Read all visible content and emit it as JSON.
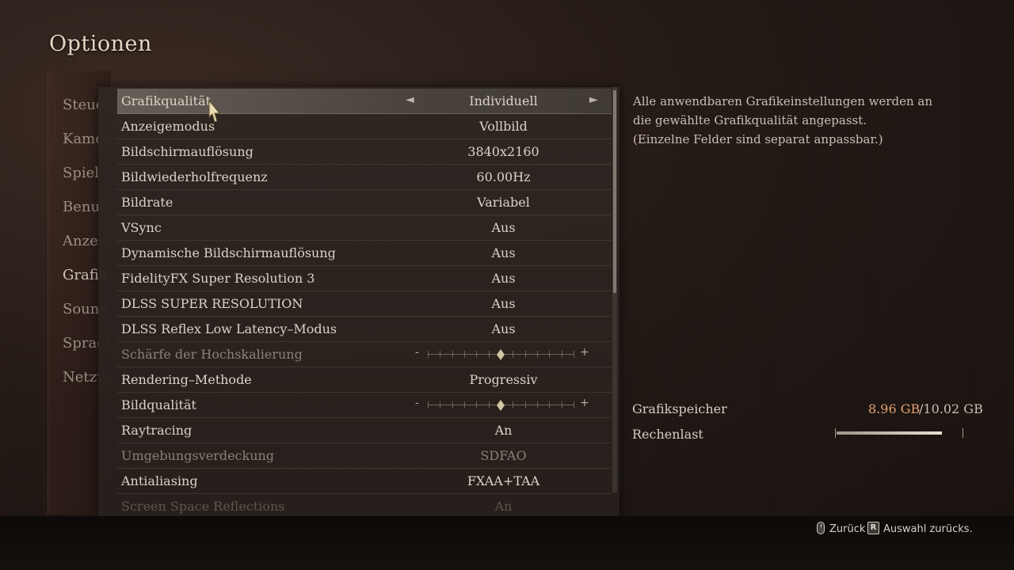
{
  "header": {
    "title": "Optionen"
  },
  "categories": [
    {
      "label": "Steuerung"
    },
    {
      "label": "Kamera"
    },
    {
      "label": "Spiel"
    },
    {
      "label": "Benutzeroberfläche"
    },
    {
      "label": "Anzeige"
    },
    {
      "label": "Grafik"
    },
    {
      "label": "Sound"
    },
    {
      "label": "Sprache"
    },
    {
      "label": "Netzwerk"
    }
  ],
  "settings": [
    {
      "label": "Grafikqualität",
      "value": "Individuell"
    },
    {
      "label": "Anzeigemodus",
      "value": "Vollbild"
    },
    {
      "label": "Bildschirmauflösung",
      "value": "3840x2160"
    },
    {
      "label": "Bildwiederholfrequenz",
      "value": "60.00Hz"
    },
    {
      "label": "Bildrate",
      "value": "Variabel"
    },
    {
      "label": "VSync",
      "value": "Aus"
    },
    {
      "label": "Dynamische Bildschirmauflösung",
      "value": "Aus"
    },
    {
      "label": "FidelityFX Super Resolution 3",
      "value": "Aus"
    },
    {
      "label": "DLSS SUPER RESOLUTION",
      "value": "Aus"
    },
    {
      "label": "DLSS Reflex Low Latency–Modus",
      "value": "Aus"
    },
    {
      "label": "Schärfe der Hochskalierung",
      "slider": 0.5
    },
    {
      "label": "Rendering–Methode",
      "value": "Progressiv"
    },
    {
      "label": "Bildqualität",
      "slider": 0.5
    },
    {
      "label": "Raytracing",
      "value": "An"
    },
    {
      "label": "Umgebungsverdeckung",
      "value": "SDFAO"
    },
    {
      "label": "Antialiasing",
      "value": "FXAA+TAA"
    },
    {
      "label": "Screen Space Reflections",
      "value": "An"
    }
  ],
  "selector": {
    "left_arrow": "◄",
    "right_arrow": "►"
  },
  "slider_marks": {
    "minus": "-",
    "plus": "+"
  },
  "description": {
    "line1": "Alle anwendbaren Grafikeinstellungen werden an",
    "line2": "die gewählte Grafikqualität angepasst.",
    "line3": "(Einzelne Felder sind separat anpassbar.)"
  },
  "stats": {
    "memory_label": "Grafikspeicher",
    "memory_used": "8.96 GB",
    "memory_total": "/10.02 GB",
    "load_label": "Rechenlast",
    "load_fraction": 0.84
  },
  "footer": {
    "back_label": "Zurück",
    "reset_key": "R",
    "reset_label": "Auswahl zurücks."
  },
  "colors": {
    "memory_used": "#e6a273",
    "selected_row": "#7a726a"
  }
}
